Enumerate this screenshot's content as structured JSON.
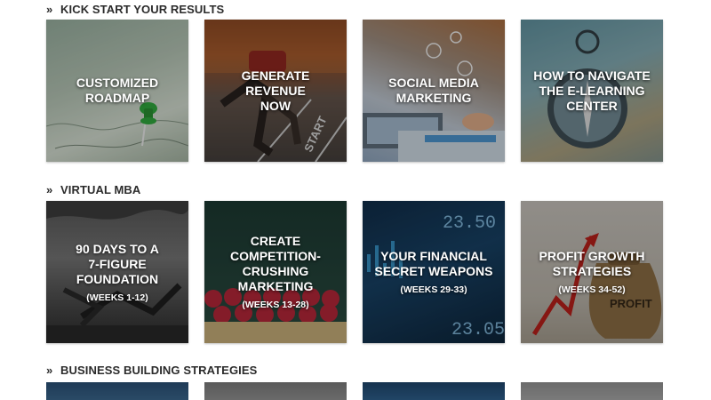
{
  "sections": [
    {
      "heading": "KICK START YOUR RESULTS",
      "cards": [
        {
          "title": "CUSTOMIZED\nROADMAP",
          "sub": ""
        },
        {
          "title": "GENERATE REVENUE\nNOW",
          "sub": ""
        },
        {
          "title": "SOCIAL MEDIA\nMARKETING",
          "sub": ""
        },
        {
          "title": "HOW TO NAVIGATE\nTHE E-LEARNING\nCENTER",
          "sub": ""
        }
      ]
    },
    {
      "heading": "VIRTUAL MBA",
      "cards": [
        {
          "title": "90 DAYS TO A\n7-FIGURE\nFOUNDATION",
          "sub": "(WEEKS 1-12)"
        },
        {
          "title": "CREATE\nCOMPETITION-\nCRUSHING\nMARKETING",
          "sub": "(WEEKS 13-28)"
        },
        {
          "title": "YOUR FINANCIAL\nSECRET WEAPONS",
          "sub": "(WEEKS 29-33)"
        },
        {
          "title": "PROFIT GROWTH\nSTRATEGIES",
          "sub": "(WEEKS 34-52)"
        }
      ]
    },
    {
      "heading": "BUSINESS BUILDING STRATEGIES",
      "cards": []
    }
  ],
  "image_text": {
    "start_line": "START",
    "ticker_1": "23.50",
    "ticker_2": "23.050",
    "profit_bag": "PROFIT"
  },
  "icons": {
    "section_chevron": "double-chevron-right-icon"
  }
}
